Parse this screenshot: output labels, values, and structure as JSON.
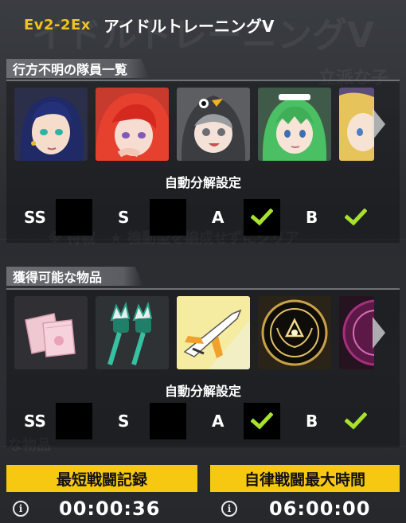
{
  "header": {
    "stage_code": "Ev2-2Ex",
    "stage_name": "アイドルトレーニングV"
  },
  "missing_members": {
    "title": "行方不明の隊員一覧",
    "portraits": [
      {
        "icon": "portrait-navy-hair-girl"
      },
      {
        "icon": "portrait-red-hair-girl"
      },
      {
        "icon": "portrait-penguin-hood-girl"
      },
      {
        "icon": "portrait-green-hair-maid"
      },
      {
        "icon": "portrait-blonde-girl-partial"
      }
    ],
    "auto_dismantle_label": "自動分解設定",
    "grades": [
      {
        "label": "SS",
        "checked": false
      },
      {
        "label": "S",
        "checked": false
      },
      {
        "label": "A",
        "checked": true
      },
      {
        "label": "B",
        "checked": true
      }
    ]
  },
  "obtainable_items": {
    "title": "獲得可能な物品",
    "items": [
      {
        "icon": "pink-envelopes-icon"
      },
      {
        "icon": "twin-crown-scepter-icon"
      },
      {
        "icon": "jet-plane-model-icon"
      },
      {
        "icon": "gold-emblem-medal-icon"
      },
      {
        "icon": "purple-orb-icon"
      }
    ],
    "auto_dismantle_label": "自動分解設定",
    "grades": [
      {
        "label": "SS",
        "checked": false
      },
      {
        "label": "S",
        "checked": false
      },
      {
        "label": "A",
        "checked": true
      },
      {
        "label": "B",
        "checked": true
      }
    ]
  },
  "stats": {
    "best_clear": {
      "label": "最短戦闘記録",
      "value": "00:00:36"
    },
    "auto_max": {
      "label": "自律戦闘最大時間",
      "value": "06:00:00"
    }
  },
  "colors": {
    "accent_yellow": "#f6c812",
    "stage_code": "#f2c21a",
    "check_green": "#a6e22e"
  }
}
